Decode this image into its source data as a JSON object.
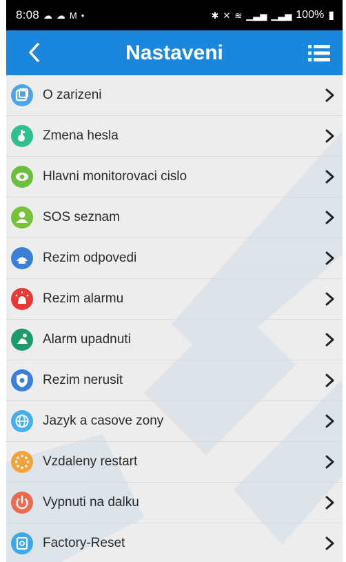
{
  "status_bar": {
    "time": "8:08",
    "left_icons": [
      "cloud-icon",
      "cloud-upload-icon",
      "gmail-icon",
      "dot-icon"
    ],
    "right_icons": [
      "bluetooth-icon",
      "mute-icon",
      "wifi-icon",
      "signal-icon",
      "signal-icon"
    ],
    "battery": "100%"
  },
  "header": {
    "title": "Nastaveni",
    "background": "#1b87dc"
  },
  "menu_items": [
    {
      "label": "O zarizeni",
      "icon": "device-info-icon",
      "color": "#4aa6e8"
    },
    {
      "label": "Zmena hesla",
      "icon": "key-icon",
      "color": "#2ec08e"
    },
    {
      "label": "Hlavni monitorovaci cislo",
      "icon": "eye-icon",
      "color": "#6bbf3c"
    },
    {
      "label": "SOS seznam",
      "icon": "contact-icon",
      "color": "#77c13b"
    },
    {
      "label": "Rezim odpovedi",
      "icon": "phone-icon",
      "color": "#3a7fd8"
    },
    {
      "label": "Rezim alarmu",
      "icon": "siren-icon",
      "color": "#e53935"
    },
    {
      "label": "Alarm upadnuti",
      "icon": "fall-icon",
      "color": "#1f9a6c"
    },
    {
      "label": "Rezim nerusit",
      "icon": "do-not-disturb-icon",
      "color": "#3a7fd8"
    },
    {
      "label": "Jazyk a casove zony",
      "icon": "globe-icon",
      "color": "#45aeec"
    },
    {
      "label": "Vzdaleny restart",
      "icon": "restart-icon",
      "color": "#f3a23a"
    },
    {
      "label": "Vypnuti na dalku",
      "icon": "power-icon",
      "color": "#ec6a50"
    },
    {
      "label": "Factory-Reset",
      "icon": "reset-icon",
      "color": "#3ca8e8"
    }
  ]
}
